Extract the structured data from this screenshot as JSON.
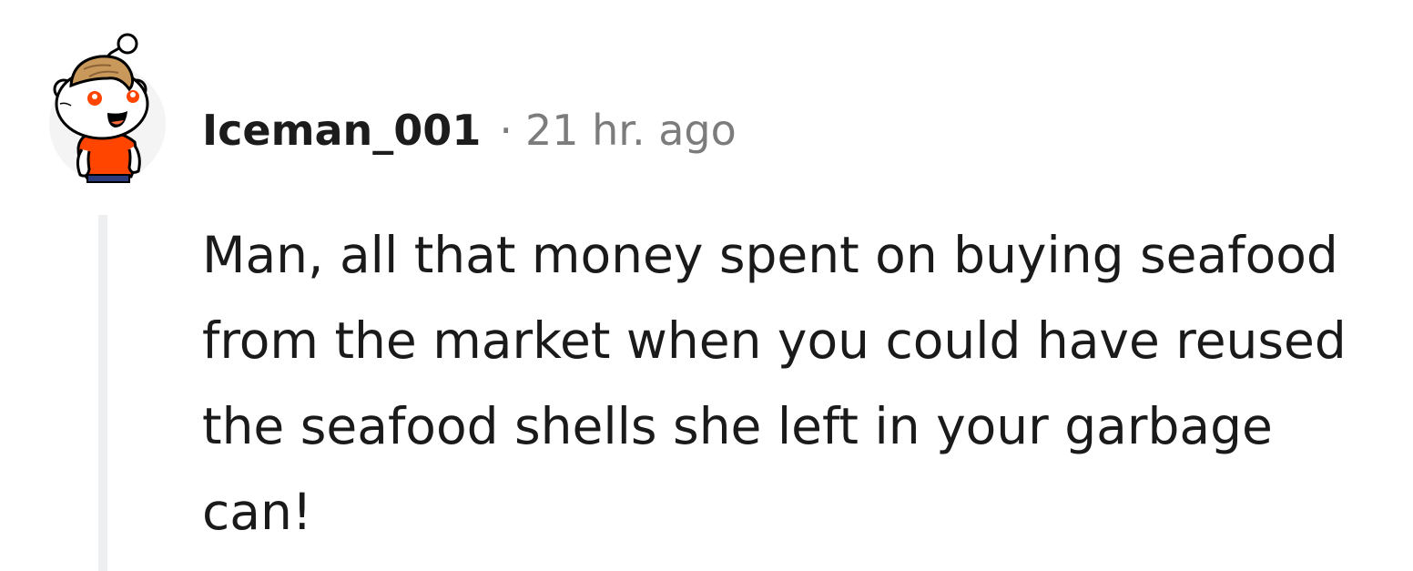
{
  "comment": {
    "username": "Iceman_001",
    "separator": "·",
    "timestamp": "21 hr. ago",
    "body": "Man, all that money spent on buying seafood from the market when you could have reused the seafood shells she left in your garbage can!"
  },
  "avatar": {
    "icon": "snoo-avatar-icon",
    "shirt_color": "#ff4500",
    "hair_color": "#c9995c",
    "eye_color": "#ff4500",
    "background_color": "#f4f4f4"
  },
  "thread_line_color": "#edeff1"
}
